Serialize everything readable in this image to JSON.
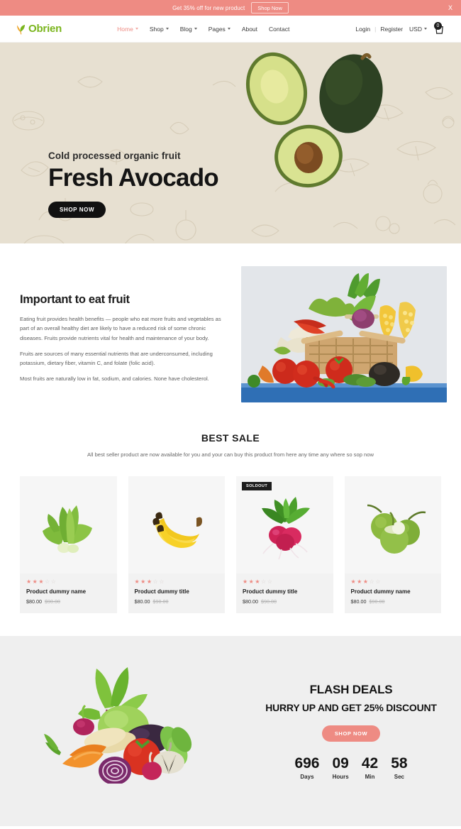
{
  "promo": {
    "text": "Get 35% off for new product",
    "button": "Shop Now",
    "close": "X"
  },
  "header": {
    "logo": "Obrien",
    "nav": [
      {
        "label": "Home",
        "caret": true,
        "active": true
      },
      {
        "label": "Shop",
        "caret": true,
        "active": false
      },
      {
        "label": "Blog",
        "caret": true,
        "active": false
      },
      {
        "label": "Pages",
        "caret": true,
        "active": false
      },
      {
        "label": "About",
        "caret": false,
        "active": false
      },
      {
        "label": "Contact",
        "caret": false,
        "active": false
      }
    ],
    "login": "Login",
    "divider": "|",
    "register": "Register",
    "currency": "USD",
    "cart_count": "0"
  },
  "hero": {
    "subtitle": "Cold processed organic fruit",
    "title": "Fresh Avocado",
    "button": "SHOP NOW"
  },
  "about": {
    "title": "Important to eat fruit",
    "paragraphs": [
      "Eating fruit provides health benefits — people who eat more fruits and vegetables as part of an overall healthy diet are likely to have a reduced risk of some chronic diseases. Fruits provide nutrients vital for health and maintenance of your body.",
      "Fruits are sources of many essential nutrients that are underconsumed, including potassium, dietary fiber, vitamin C, and folate (folic acid).",
      "Most fruits are naturally low in fat, sodium, and calories. None have cholesterol."
    ]
  },
  "best_sale": {
    "title": "BEST SALE",
    "description": "All best seller product are now available for you and your can buy this product from here any time any where so sop now",
    "products": [
      {
        "name": "Product dummy name",
        "price": "$80.00",
        "old_price": "$90.00",
        "rating": 3,
        "max_rating": 5,
        "badge": "",
        "image": "bok-choy"
      },
      {
        "name": "Product dummy title",
        "price": "$80.00",
        "old_price": "$90.00",
        "rating": 3,
        "max_rating": 5,
        "badge": "",
        "image": "bananas"
      },
      {
        "name": "Product dummy title",
        "price": "$80.00",
        "old_price": "$90.00",
        "rating": 3,
        "max_rating": 5,
        "badge": "SOLDOUT",
        "image": "radishes"
      },
      {
        "name": "Product dummy name",
        "price": "$80.00",
        "old_price": "$90.00",
        "rating": 3,
        "max_rating": 5,
        "badge": "",
        "image": "coconuts"
      }
    ]
  },
  "flash_deals": {
    "title": "FLASH DEALS",
    "subtitle": "HURRY UP AND GET 25% DISCOUNT",
    "button": "SHOP NOW",
    "countdown": [
      {
        "value": "696",
        "label": "Days"
      },
      {
        "value": "09",
        "label": "Hours"
      },
      {
        "value": "42",
        "label": "Min"
      },
      {
        "value": "58",
        "label": "Sec"
      }
    ]
  },
  "colors": {
    "accent": "#ee8b83",
    "brand": "#7ab51d",
    "hero_bg": "#e7e0d1",
    "flash_bg": "#efefef",
    "dark": "#1d1d1d"
  }
}
